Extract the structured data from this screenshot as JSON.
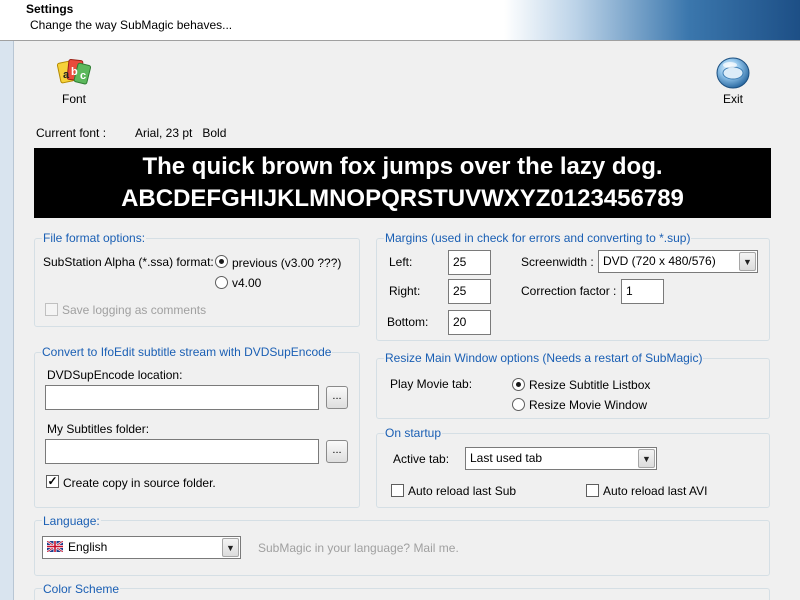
{
  "header": {
    "title": "Settings",
    "subtitle": "Change the way SubMagic behaves..."
  },
  "toolbar": {
    "font_label": "Font",
    "exit_label": "Exit"
  },
  "current_font": {
    "label": "Current font :",
    "value": "Arial, 23 pt   Bold"
  },
  "preview": {
    "line1": "The quick brown fox jumps over the lazy dog.",
    "line2": "ABCDEFGHIJKLMNOPQRSTUVWXYZ0123456789"
  },
  "file_format": {
    "title": "File format options:",
    "ssa_label": "SubStation Alpha (*.ssa) format:",
    "option_previous": "previous (v3.00  ???)",
    "option_v4": "v4.00",
    "selected": "previous (v3.00  ???)",
    "save_logging": "Save logging as comments",
    "save_logging_checked": false
  },
  "margins": {
    "title": "Margins (used in check for errors and converting to *.sup)",
    "left_label": "Left:",
    "left_value": "25",
    "right_label": "Right:",
    "right_value": "25",
    "bottom_label": "Bottom:",
    "bottom_value": "20",
    "screenwidth_label": "Screenwidth :",
    "screenwidth_value": "DVD (720 x 480/576)",
    "correction_label": "Correction factor :",
    "correction_value": "1"
  },
  "convert": {
    "title": "Convert to IfoEdit subtitle stream with DVDSupEncode",
    "location_label": "DVDSupEncode location:",
    "location_value": "",
    "subtitles_label": "My Subtitles folder:",
    "subtitles_value": "",
    "browse_label": "...",
    "copy_label": "Create copy in source folder.",
    "copy_checked": true
  },
  "resize": {
    "title": "Resize Main Window options (Needs a restart of SubMagic)",
    "play_movie_label": "Play Movie tab:",
    "option_listbox": "Resize Subtitle Listbox",
    "option_movie": "Resize Movie Window",
    "selected": "Resize Subtitle Listbox"
  },
  "startup": {
    "title": "On startup",
    "active_tab_label": "Active tab:",
    "active_tab_value": "Last used tab",
    "auto_sub": "Auto reload last Sub",
    "auto_avi": "Auto reload last AVI",
    "auto_sub_checked": false,
    "auto_avi_checked": false
  },
  "language": {
    "title": "Language:",
    "value": "English",
    "hint": "SubMagic in your language? Mail me."
  },
  "color_scheme": {
    "title": "Color Scheme"
  },
  "icons": {
    "font": "font-icon",
    "exit": "exit-icon",
    "flag": "uk-flag-icon",
    "dropdown": "chevron-down-icon"
  }
}
